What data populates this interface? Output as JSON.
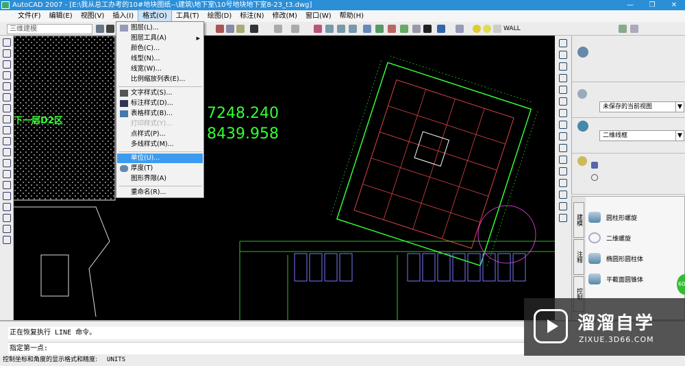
{
  "window": {
    "title": "AutoCAD 2007 - [E:\\我从总工办考的10#地块图纸--\\建筑\\地下室\\10号地块地下室8-23_t3.dwg]",
    "minimize": "—",
    "restore": "❐",
    "close": "✕"
  },
  "menubar": [
    "文件(F)",
    "编辑(E)",
    "视图(V)",
    "插入(I)",
    "格式(O)",
    "工具(T)",
    "绘图(D)",
    "标注(N)",
    "修改(M)",
    "窗口(W)",
    "帮助(H)"
  ],
  "toolbar": {
    "workspace": "三维建模",
    "layer": "WALL"
  },
  "format_menu": [
    {
      "label": "图层(L)...",
      "icon": "layers-icon"
    },
    {
      "label": "图层工具(A)",
      "submenu": "▶"
    },
    {
      "label": "颜色(C)..."
    },
    {
      "label": "线型(N)..."
    },
    {
      "label": "线宽(W)..."
    },
    {
      "label": "比例缩放列表(E)..."
    },
    {
      "label": "文字样式(S)...",
      "icon": "text-style-icon"
    },
    {
      "label": "标注样式(D)...",
      "icon": "dimension-style-icon"
    },
    {
      "label": "表格样式(B)...",
      "icon": "table-style-icon"
    },
    {
      "label": "打印样式(Y)...",
      "disabled": true
    },
    {
      "label": "点样式(P)..."
    },
    {
      "label": "多线样式(M)..."
    },
    {
      "label": "单位(U)...",
      "highlighted": true
    },
    {
      "label": "厚度(T)",
      "icon": "thickness-icon"
    },
    {
      "label": "图形界限(A)"
    },
    {
      "label": "重命名(R)..."
    }
  ],
  "drawing": {
    "label": "下一层D2区",
    "coord1": "7248.240",
    "coord2": "8439.958"
  },
  "dashboard": {
    "view": "未保存的当前视图",
    "visual_style": "二维线框"
  },
  "tool_palette": {
    "tabs": [
      "建模",
      "注释",
      "控制"
    ],
    "items": [
      "圆柱形螺旋",
      "二维螺旋",
      "椭圆形圆柱体",
      "平截面圆锥体"
    ]
  },
  "command": {
    "line1": "正在恢复执行 LINE 命令。",
    "line2": "指定第一点:"
  },
  "status": {
    "text": "控制坐标和角度的显示格式和精度:",
    "command": "UNITS"
  },
  "watermark": {
    "title": "溜溜自学",
    "subtitle": "ZIXUE.3D66.COM"
  },
  "badge": "60"
}
